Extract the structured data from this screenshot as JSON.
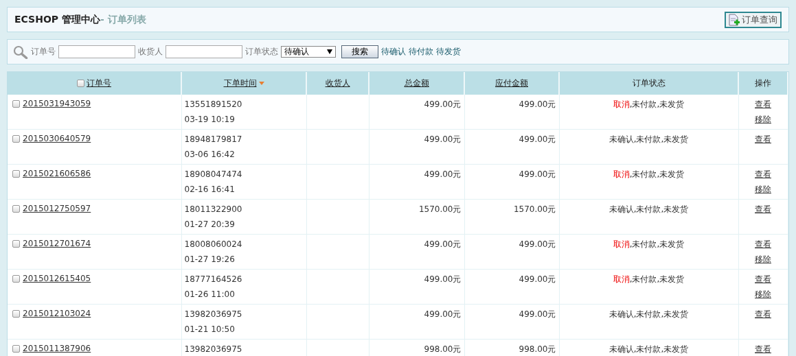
{
  "header": {
    "title": "ECSHOP 管理中心",
    "subtitle": "- 订单列表",
    "action_button": "订单查询"
  },
  "search": {
    "order_no_label": "订单号",
    "consignee_label": "收货人",
    "status_label": "订单状态",
    "status_select": "待确认",
    "search_button": "搜索",
    "quick_links": [
      "待确认",
      "待付款",
      "待发货"
    ]
  },
  "table": {
    "select_all": {
      "checked": false
    },
    "columns": [
      {
        "label": "订单号",
        "sortable": true,
        "sorted": false
      },
      {
        "label": "下单时间",
        "sortable": true,
        "sorted": true
      },
      {
        "label": "收货人",
        "sortable": true,
        "sorted": false
      },
      {
        "label": "总金额",
        "sortable": true,
        "sorted": false
      },
      {
        "label": "应付金额",
        "sortable": true,
        "sorted": false
      },
      {
        "label": "订单状态",
        "sortable": false,
        "sorted": false
      },
      {
        "label": "操作",
        "sortable": false,
        "sorted": false
      }
    ],
    "rows": [
      {
        "checked": false,
        "order_no": "2015031943059",
        "phone": "13551891520",
        "time": "03-19 10:19",
        "total": "499.00元",
        "payable": "499.00元",
        "status_first": "取消",
        "cancelled": true,
        "status_rest": ",未付款,未发货",
        "actions": [
          "查看",
          "移除"
        ]
      },
      {
        "checked": false,
        "order_no": "2015030640579",
        "phone": "18948179817",
        "time": "03-06 16:42",
        "total": "499.00元",
        "payable": "499.00元",
        "status_first": "未确认",
        "cancelled": false,
        "status_rest": ",未付款,未发货",
        "actions": [
          "查看"
        ]
      },
      {
        "checked": false,
        "order_no": "2015021606586",
        "phone": "18908047474",
        "time": "02-16 16:41",
        "total": "499.00元",
        "payable": "499.00元",
        "status_first": "取消",
        "cancelled": true,
        "status_rest": ",未付款,未发货",
        "actions": [
          "查看",
          "移除"
        ]
      },
      {
        "checked": false,
        "order_no": "2015012750597",
        "phone": "18011322900",
        "time": "01-27 20:39",
        "total": "1570.00元",
        "payable": "1570.00元",
        "status_first": "未确认",
        "cancelled": false,
        "status_rest": ",未付款,未发货",
        "actions": [
          "查看"
        ]
      },
      {
        "checked": false,
        "order_no": "2015012701674",
        "phone": "18008060024",
        "time": "01-27 19:26",
        "total": "499.00元",
        "payable": "499.00元",
        "status_first": "取消",
        "cancelled": true,
        "status_rest": ",未付款,未发货",
        "actions": [
          "查看",
          "移除"
        ]
      },
      {
        "checked": false,
        "order_no": "2015012615405",
        "phone": "18777164526",
        "time": "01-26 11:00",
        "total": "499.00元",
        "payable": "499.00元",
        "status_first": "取消",
        "cancelled": true,
        "status_rest": ",未付款,未发货",
        "actions": [
          "查看",
          "移除"
        ]
      },
      {
        "checked": false,
        "order_no": "2015012103024",
        "phone": "13982036975",
        "time": "01-21 10:50",
        "total": "499.00元",
        "payable": "499.00元",
        "status_first": "未确认",
        "cancelled": false,
        "status_rest": ",未付款,未发货",
        "actions": [
          "查看"
        ]
      },
      {
        "checked": false,
        "order_no": "2015011387906",
        "phone": "13982036975",
        "total": "998.00元",
        "payable": "998.00元",
        "status_first": "未确认",
        "cancelled": false,
        "status_rest": ",未付款,未发货",
        "actions": [
          "查看"
        ]
      }
    ]
  }
}
